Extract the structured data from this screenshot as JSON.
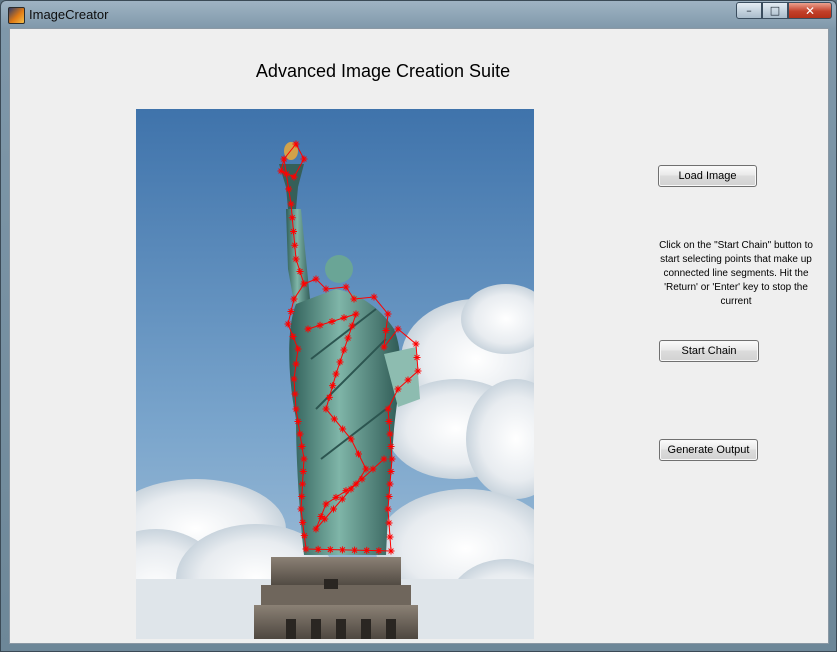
{
  "window": {
    "title": "ImageCreator",
    "minimize_glyph": "–",
    "maximize_glyph": "□",
    "close_glyph": "✕"
  },
  "app": {
    "heading": "Advanced Image Creation Suite"
  },
  "controls": {
    "load_image_label": "Load Image",
    "instructions": "Click on the \"Start Chain\" button to start selecting points that make up connected line segments. Hit the 'Return' or 'Enter' key to stop the current",
    "start_chain_label": "Start Chain",
    "generate_output_label": "Generate Output"
  },
  "image": {
    "subject": "Statue of Liberty against blue sky with clouds",
    "marker_color": "#ff0000",
    "marker_glyph": "asterisk"
  },
  "icons": [
    "matlab-app-icon",
    "minimize-icon",
    "maximize-icon",
    "close-icon"
  ]
}
